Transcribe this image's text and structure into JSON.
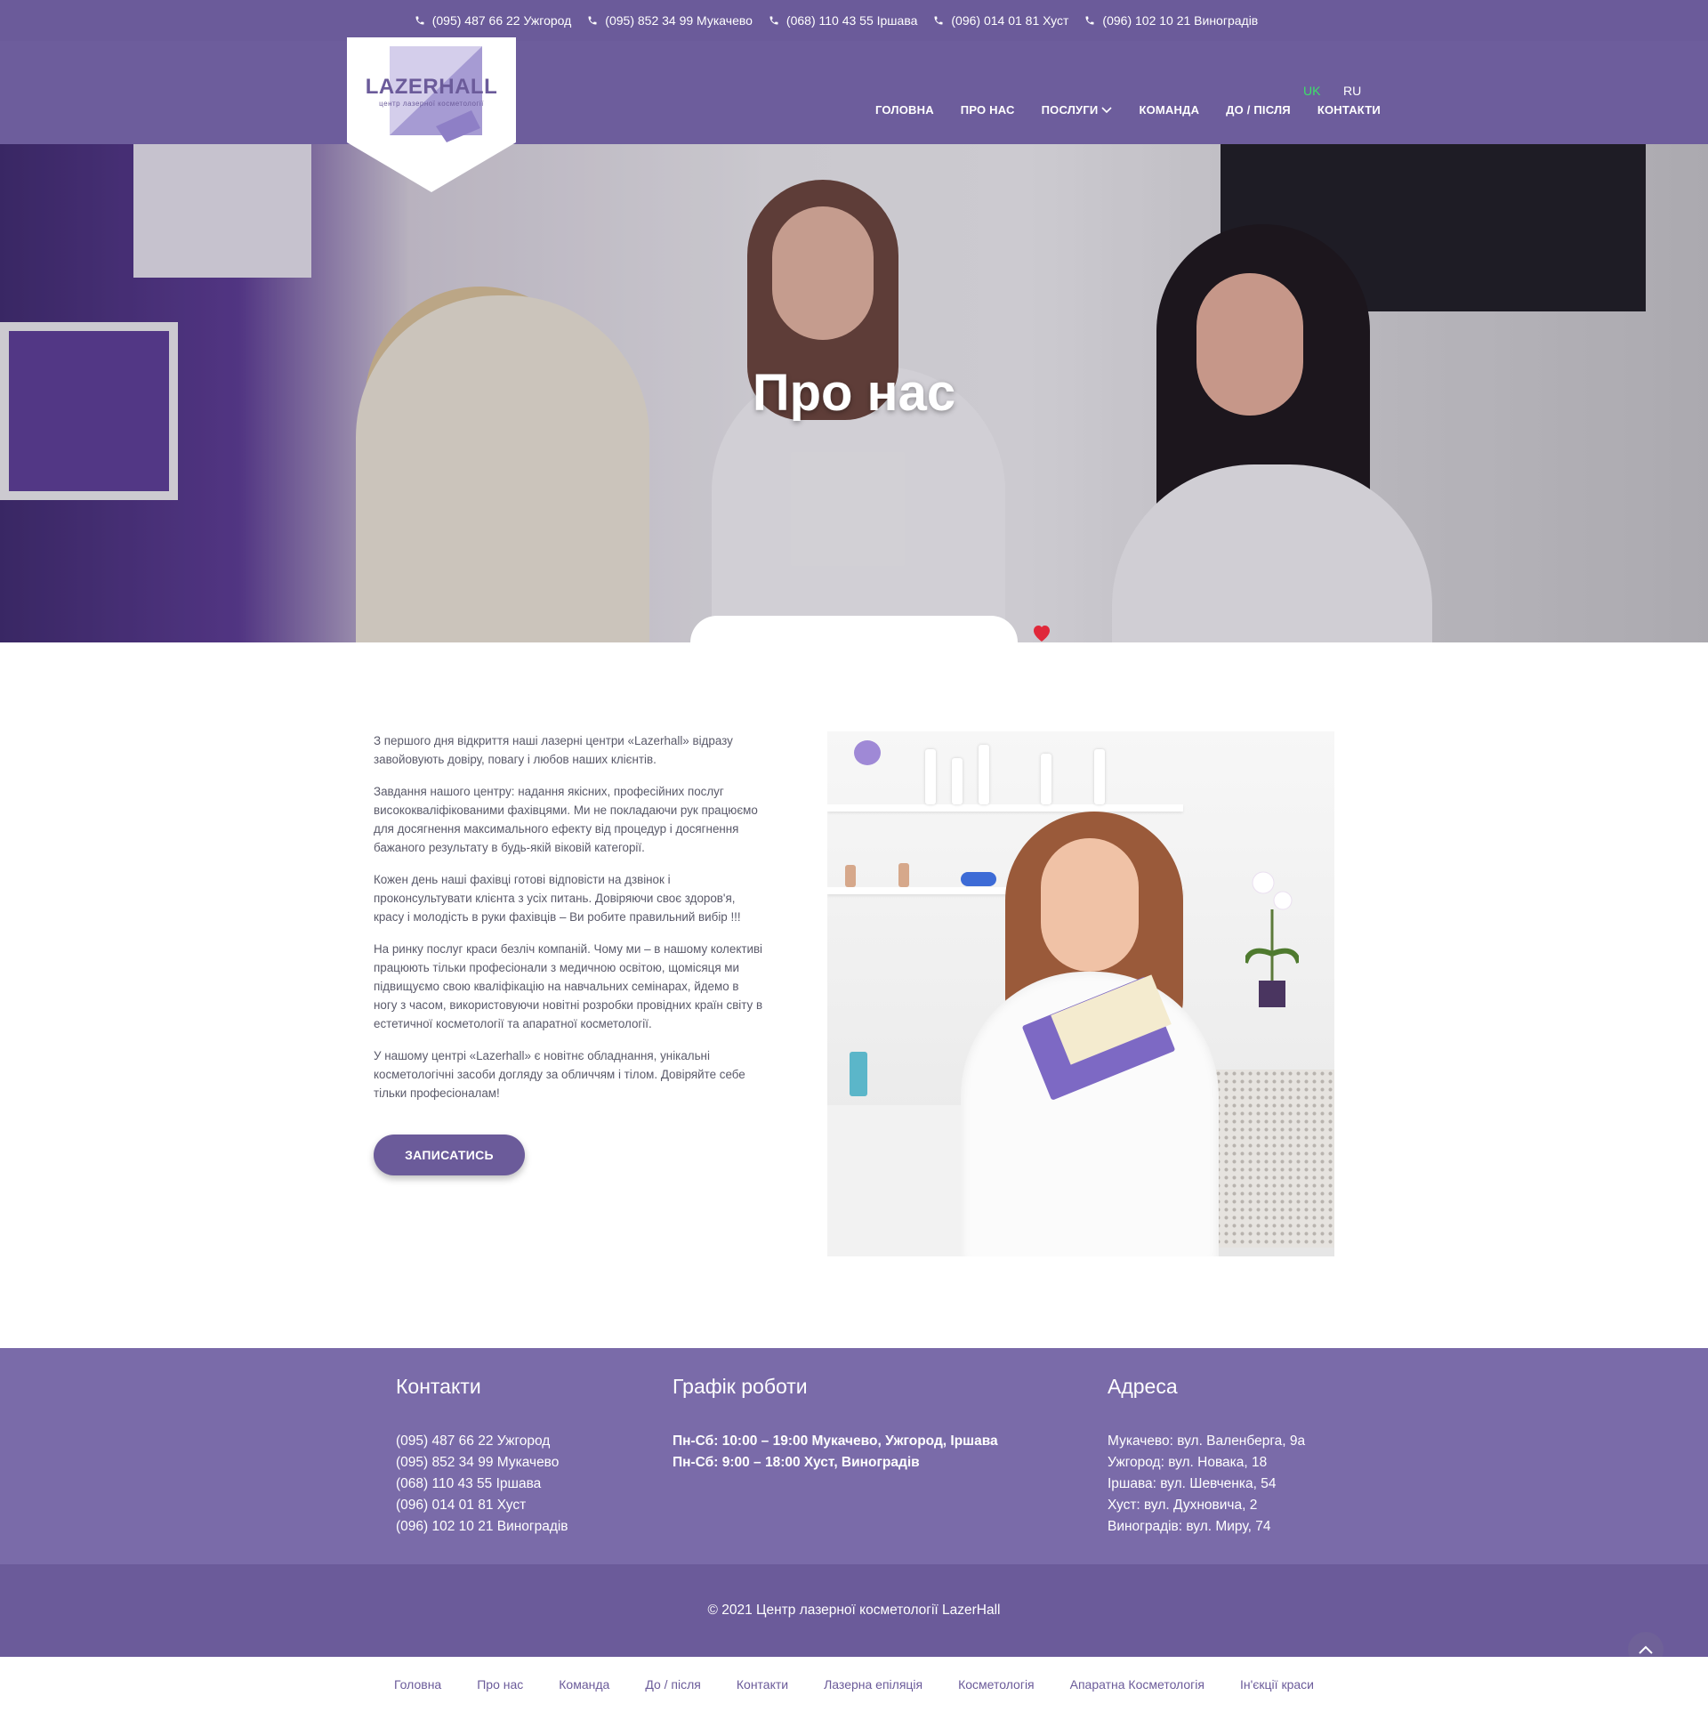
{
  "topbar": {
    "phones": [
      "(095) 487 66 22 Ужгород",
      "(095) 852 34 99 Мукачево",
      "(068) 110 43 55 Іршава",
      "(096) 014 01 81 Хуст",
      "(096) 102 10 21 Виноградів"
    ]
  },
  "header": {
    "logo_text": "LAZERHALL",
    "logo_subtitle": "центр лазерної косметології",
    "lang": {
      "uk": "UK",
      "ru": "RU"
    },
    "nav": [
      "ГОЛОВНА",
      "ПРО НАС",
      "ПОСЛУГИ",
      "КОМАНДА",
      "ДО / ПІСЛЯ",
      "КОНТАКТИ"
    ]
  },
  "hero": {
    "title": "Про нас"
  },
  "about": {
    "paragraphs": [
      "З першого дня відкриття наші лазерні центри «Lazerhall»  відразу завойовують довіру, повагу і любов наших клієнтів.",
      "Завдання нашого центру: надання якісних, професійних послуг висококваліфікованими фахівцями. Ми не покладаючи рук працюємо для досягнення максимального ефекту від процедур і досягнення бажаного результату в будь-якій віковій категорії.",
      "Кожен день наші фахівці готові відповісти на дзвінок і проконсультувати клієнта з усіх питань. Довіряючи своє здоров'я, красу і молодість в руки фахівців – Ви робите правильний вибір !!!",
      "На ринку послуг краси безліч компаній. Чому ми – в нашому колективі працюють тільки професіонали з медичною освітою, щомісяця ми підвищуємо свою кваліфікацію на навчальних семінарах, йдемо в ногу з часом, використовуючи новітні розробки провідних країн світу в естетичної косметології та апаратної косметології.",
      "У нашому центрі «Lazerhall» є новітнє обладнання, унікальні косметологічні засоби догляду за обличчям і тілом. Довіряйте себе тільки професіоналам!"
    ],
    "cta_label": "ЗАПИСАТИСЬ"
  },
  "footer": {
    "contacts_title": "Контакти",
    "contacts": [
      "(095) 487 66 22 Ужгород",
      "(095) 852 34 99 Мукачево",
      "(068) 110 43 55 Іршава",
      "(096) 014 01 81 Хуст",
      "(096) 102 10 21 Виноградів"
    ],
    "schedule_title": "Графік роботи",
    "schedule": [
      "Пн-Сб: 10:00 – 19:00 Мукачево, Ужгород, Іршава",
      "Пн-Сб: 9:00 – 18:00 Хуст, Виноградів"
    ],
    "address_title": "Адреса",
    "addresses": [
      "Мукачево: вул. Валенберга, 9а",
      "Ужгород: вул. Новака, 18",
      "Іршава: вул. Шевченка, 54",
      "Хуст: вул. Духновича, 2",
      "Виноградів: вул. Миру, 74"
    ],
    "copyright": "© 2021 Центр лазерної косметології LazerHall"
  },
  "bottom_nav": [
    "Головна",
    "Про нас",
    "Команда",
    "До / після",
    "Контакти",
    "Лазерна епіляція",
    "Косметологія",
    "Апаратна Косметологія",
    "Ін'єкції краси"
  ],
  "colors": {
    "brand": "#6b5b9a",
    "footer": "#7a6ba9",
    "lang_active": "#3de06a",
    "heart": "#e0283a"
  },
  "icons": [
    "phone-icon",
    "chevron-down-icon",
    "heart-icon",
    "chevron-up-icon"
  ]
}
